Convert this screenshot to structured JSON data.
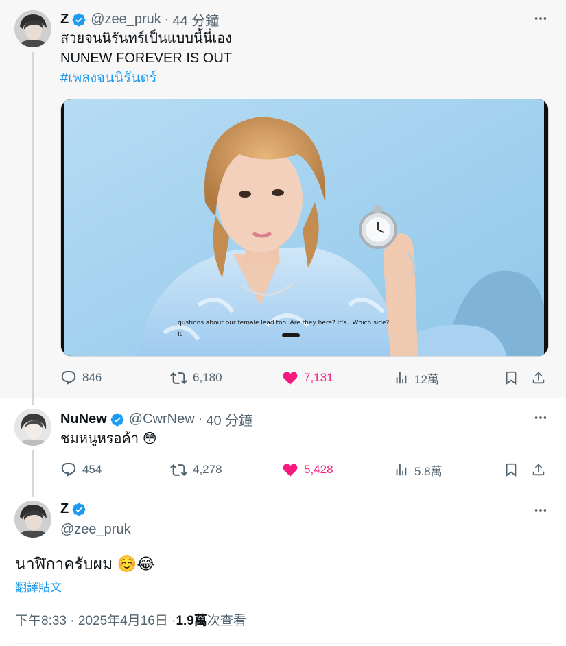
{
  "colors": {
    "accent": "#1d9bf0",
    "like": "#f91880",
    "muted": "#536471",
    "text": "#0f1419",
    "verified": "#1d9bf0"
  },
  "tweets": [
    {
      "name": "Z",
      "handle": "@zee_pruk",
      "time": "44 分鐘",
      "line1": "สวยจนนิรันทร์เป็นแบบนี้นี่เอง",
      "line2": "NUNEW FOREVER IS OUT",
      "hashtag": "#เพลงจนนิรันดร์",
      "media_caption_line1": "qustions about our female lead too. Are they here? It's.. Which side?",
      "media_caption_line2": "It",
      "stats": {
        "replies": "846",
        "reposts": "6,180",
        "likes": "7,131",
        "views": "12萬"
      }
    },
    {
      "name": "NuNew",
      "handle": "@CwrNew",
      "time": "40 分鐘",
      "text": "ชมหนูหรอค้า",
      "emoji": "😳",
      "stats": {
        "replies": "454",
        "reposts": "4,278",
        "likes": "5,428",
        "views": "5.8萬"
      }
    }
  ],
  "focused": {
    "name": "Z",
    "handle": "@zee_pruk",
    "text": "นาฬิกาครับผม",
    "emoji": "☺️😂",
    "translate": "翻譯貼文",
    "time": "下午8:33 · 2025年4月16日 · ",
    "views_count": "1.9萬",
    "views_label": " 次查看"
  },
  "icons": [
    "verified-badge-icon",
    "more-icon",
    "reply-icon",
    "repost-icon",
    "like-icon",
    "views-icon",
    "bookmark-icon",
    "share-icon"
  ]
}
